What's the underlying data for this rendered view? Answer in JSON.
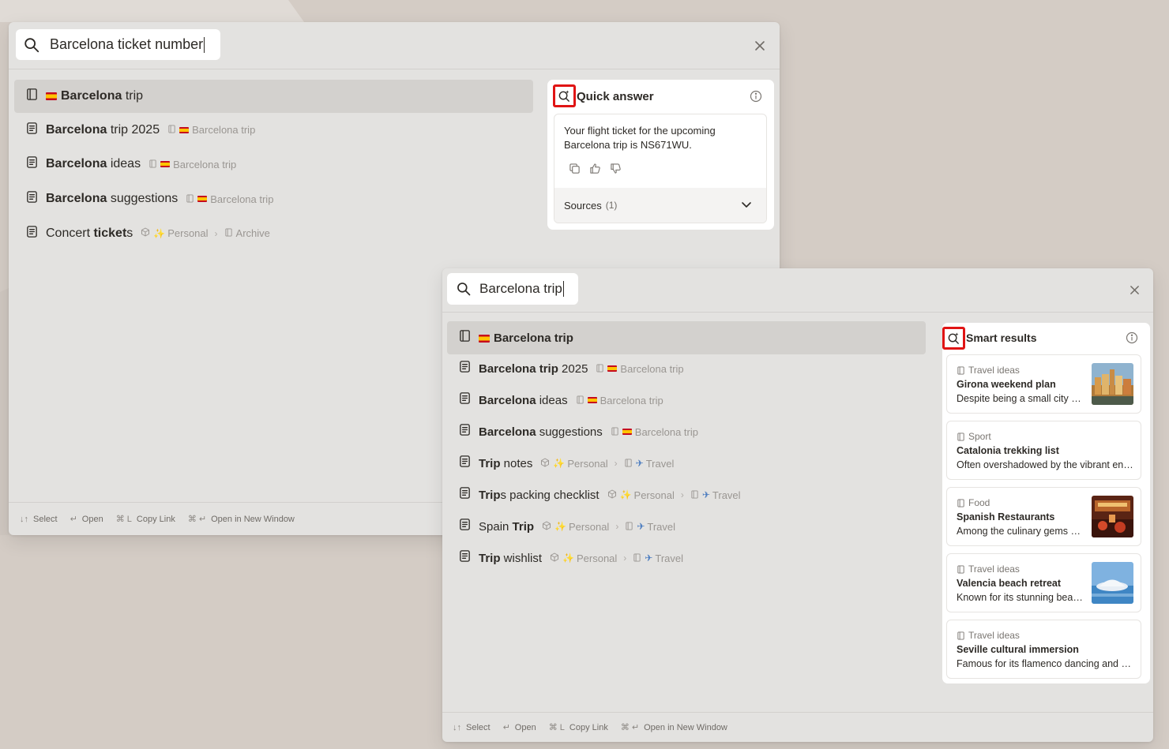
{
  "colors": {
    "background": "#d4ccc5",
    "panel": "#e3e2e0",
    "highlight": "#e01414",
    "selected_row": "#d3d1ce"
  },
  "panel1": {
    "search": {
      "value": "Barcelona ticket number"
    },
    "results": [
      {
        "pre": "",
        "bold": "Barcelona",
        "post": " trip",
        "flag": true,
        "icon": "page-icon",
        "selected": true
      },
      {
        "pre": "",
        "bold": "Barcelona",
        "post": " trip 2025",
        "parent": "Barcelona trip"
      },
      {
        "pre": "",
        "bold": "Barcelona",
        "post": " ideas",
        "parent": "Barcelona trip"
      },
      {
        "pre": "",
        "bold": "Barcelona",
        "post": " suggestions",
        "parent": "Barcelona trip"
      },
      {
        "pre": "Concert ",
        "bold": "ticket",
        "post": "s",
        "workspace": "Personal",
        "folder": "Archive"
      }
    ],
    "quick_answer": {
      "title": "Quick answer",
      "text": "Your flight ticket for the upcoming Barcelona trip is NS671WU.",
      "sources_label": "Sources",
      "sources_count": "(1)"
    },
    "footer": [
      {
        "key": "↓↑",
        "label": "Select"
      },
      {
        "key": "↵",
        "label": "Open"
      },
      {
        "key": "⌘ L",
        "label": "Copy Link"
      },
      {
        "key": "⌘ ↵",
        "label": "Open in New Window"
      }
    ]
  },
  "panel2": {
    "search": {
      "value": "Barcelona trip"
    },
    "results": [
      {
        "pre": "",
        "bold": "Barcelona trip",
        "post": "",
        "flag": true,
        "icon": "page-icon",
        "selected": true
      },
      {
        "pre": "",
        "bold": "Barcelona trip",
        "post": " 2025",
        "parent": "Barcelona trip"
      },
      {
        "pre": "",
        "bold": "Barcelona",
        "post": " ideas",
        "parent": "Barcelona trip"
      },
      {
        "pre": "",
        "bold": "Barcelona",
        "post": " suggestions",
        "parent": "Barcelona trip"
      },
      {
        "pre": "",
        "bold": "Trip",
        "post": " notes",
        "workspace": "Personal",
        "folder": "Travel"
      },
      {
        "pre": "",
        "bold": "Trip",
        "post": "s packing checklist",
        "workspace": "Personal",
        "folder": "Travel"
      },
      {
        "pre": "Spain ",
        "bold": "Trip",
        "post": "",
        "workspace": "Personal",
        "folder": "Travel"
      },
      {
        "pre": "",
        "bold": "Trip",
        "post": " wishlist",
        "workspace": "Personal",
        "folder": "Travel"
      }
    ],
    "smart_results": {
      "title": "Smart results",
      "items": [
        {
          "category": "Travel ideas",
          "title": "Girona weekend plan",
          "desc": "Despite being a small city with a rich history",
          "thumb": "girona"
        },
        {
          "category": "Sport",
          "title": "Catalonia trekking list",
          "desc": "Often overshadowed by the vibrant energy of the coast",
          "thumb": ""
        },
        {
          "category": "Food",
          "title": "Spanish Restaurants",
          "desc": "Among the culinary gems of the region",
          "thumb": "restaurant"
        },
        {
          "category": "Travel ideas",
          "title": "Valencia beach retreat",
          "desc": "Known for its stunning beaches and modern architecture",
          "thumb": "valencia"
        },
        {
          "category": "Travel ideas",
          "title": "Seville cultural immersion",
          "desc": "Famous for its flamenco dancing and historic architecture",
          "thumb": ""
        }
      ]
    },
    "footer": [
      {
        "key": "↓↑",
        "label": "Select"
      },
      {
        "key": "↵",
        "label": "Open"
      },
      {
        "key": "⌘ L",
        "label": "Copy Link"
      },
      {
        "key": "⌘ ↵",
        "label": "Open in New Window"
      }
    ]
  }
}
